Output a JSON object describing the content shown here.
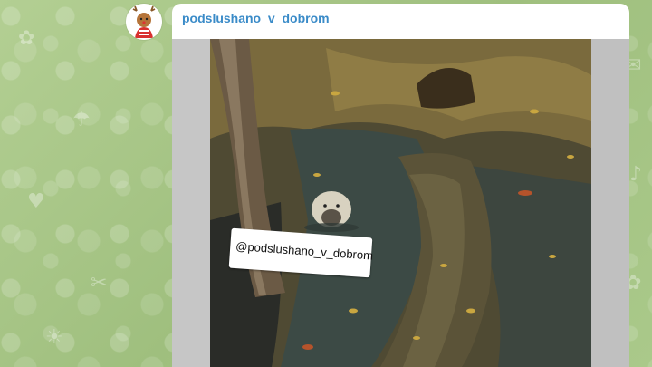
{
  "chat": {
    "channel_name": "podslushano_v_dobrom",
    "avatar_icon": "deer-avatar-icon"
  },
  "post": {
    "media_type": "video-frame",
    "sticker_text": "@podslushano_v_dobrom"
  },
  "colors": {
    "wallpaper": "#a8c58a",
    "channel_name": "#3a8bc8",
    "bubble": "#ffffff"
  }
}
